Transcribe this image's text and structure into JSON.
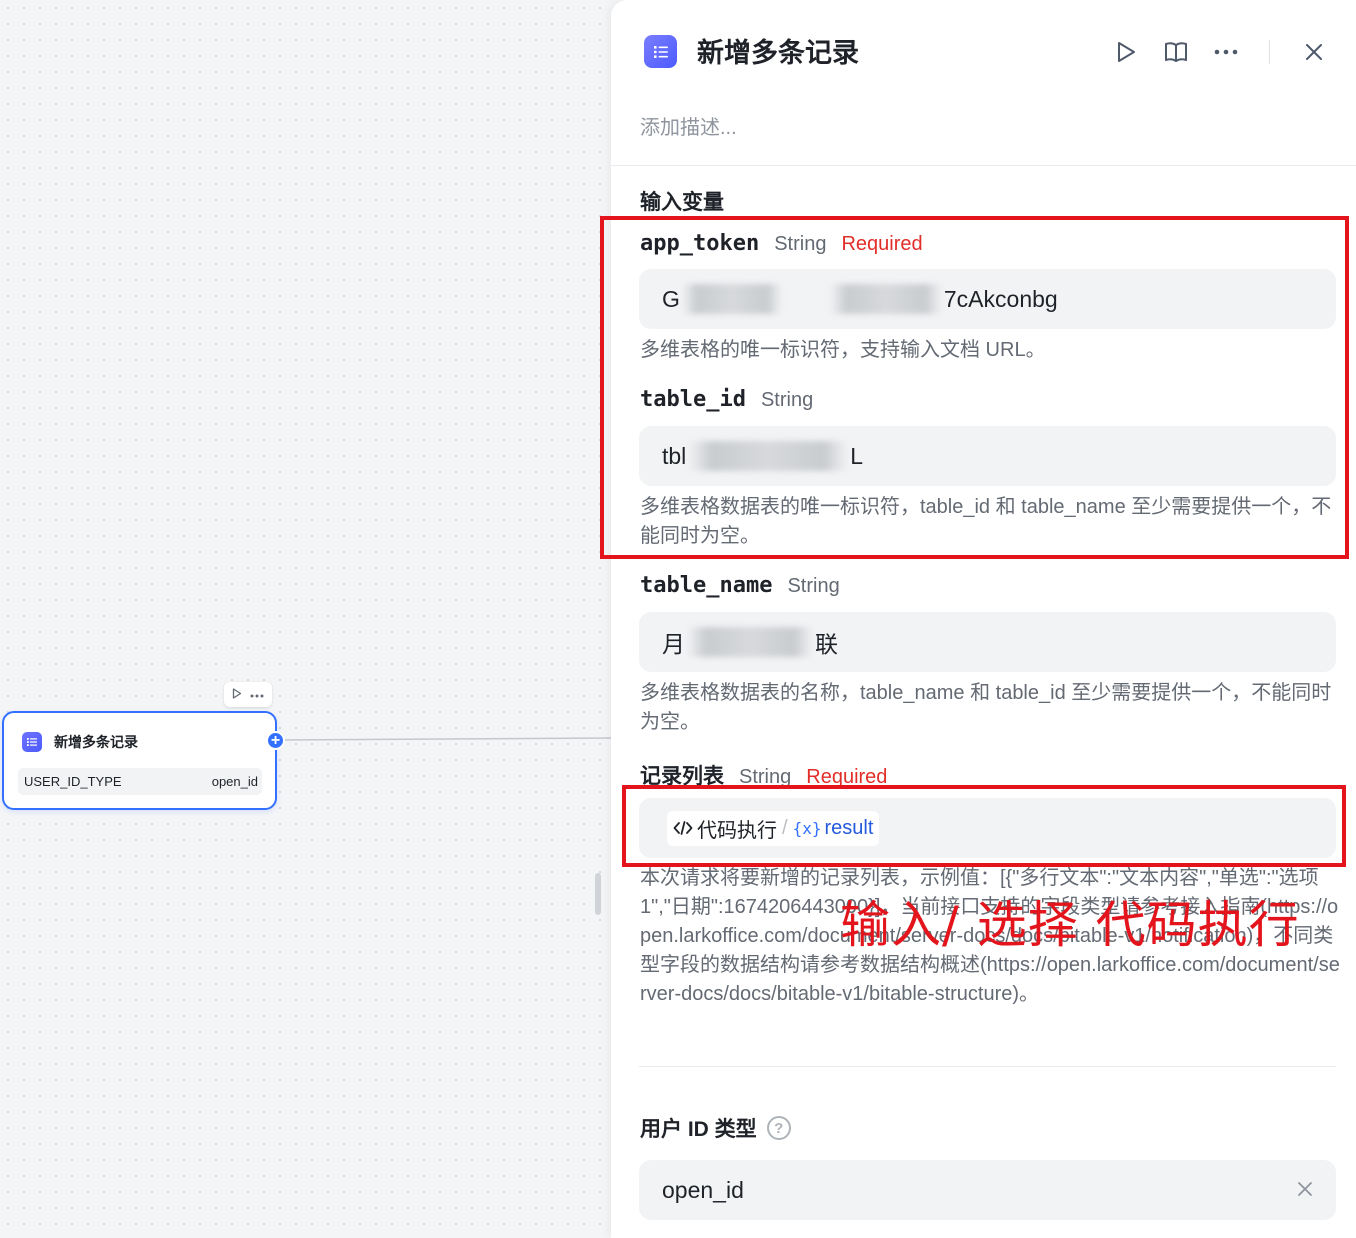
{
  "canvas": {
    "node": {
      "title": "新增多条记录",
      "param_key": "USER_ID_TYPE",
      "param_value": "open_id",
      "toolbar_run_icon": "play-icon",
      "toolbar_more_icon": "more-icon",
      "add_icon": "plus-icon"
    }
  },
  "panel": {
    "icon": "table-list-icon",
    "title": "新增多条记录",
    "actions": [
      "play-icon",
      "book-icon",
      "more-icon",
      "close-icon"
    ],
    "description_placeholder": "添加描述...",
    "section_title": "输入变量",
    "fields": {
      "app_token": {
        "name": "app_token",
        "type": "String",
        "required": "Required",
        "value_visible_start": "G",
        "value_visible_end": "7cAkconbg",
        "help": "多维表格的唯一标识符，支持输入文档 URL。"
      },
      "table_id": {
        "name": "table_id",
        "type": "String",
        "value_visible_start": "tbl",
        "value_visible_end": "L",
        "help": "多维表格数据表的唯一标识符，table_id 和 table_name 至少需要提供一个，不能同时为空。"
      },
      "table_name": {
        "name": "table_name",
        "type": "String",
        "value_visible_start": "月",
        "value_visible_end": "联",
        "help": "多维表格数据表的名称，table_name 和 table_id 至少需要提供一个，不能同时为空。"
      },
      "records": {
        "name": "记录列表",
        "type": "String",
        "required": "Required",
        "ref_node": "代码执行",
        "ref_separator": "/",
        "ref_variable": "result",
        "help": "本次请求将要新增的记录列表，示例值：[{\"多行文本\":\"文本内容\",\"单选\":\"选项 1\",\"日期\":1674206443000}]，当前接口支持的字段类型请参考接入指南(https://open.larkoffice.com/document/server-docs/docs/bitable-v1/notification)，不同类型字段的数据结构请参考数据结构概述(https://open.larkoffice.com/document/server-docs/docs/bitable-v1/bitable-structure)。"
      }
    },
    "user_id_type": {
      "label": "用户 ID 类型",
      "value": "open_id"
    }
  },
  "annotations": {
    "text": "输入/ 选择 代码执行",
    "color": "#e3141b"
  },
  "colors": {
    "accent": "#3370ff",
    "required": "#e22e28",
    "annotation": "#e3141b"
  }
}
